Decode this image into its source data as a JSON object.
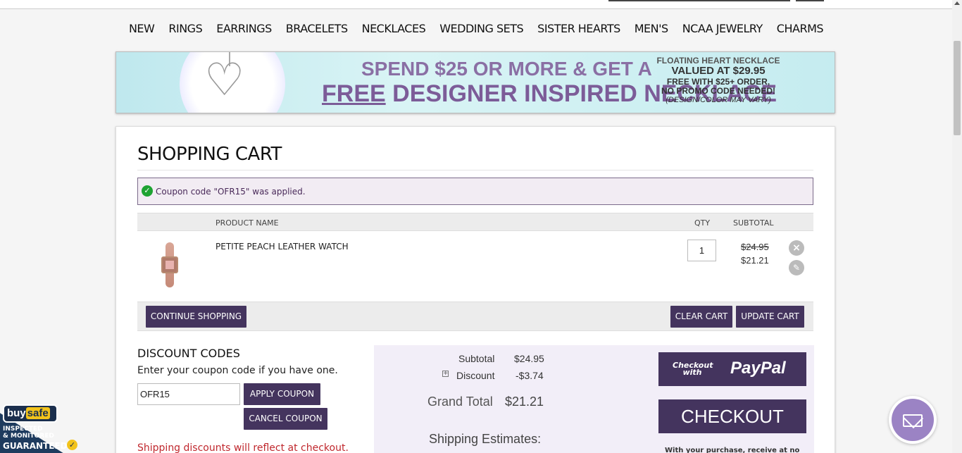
{
  "nav": [
    "NEW",
    "RINGS",
    "EARRINGS",
    "BRACELETS",
    "NECKLACES",
    "WEDDING SETS",
    "SISTER HEARTS",
    "MEN'S",
    "NCAA JEWELRY",
    "CHARMS"
  ],
  "banner": {
    "line1": "SPEND $25 OR MORE & GET A",
    "line2_free": "FREE",
    "line2_rest": " DESIGNER INSPIRED NECKLACE",
    "right1": "FLOATING HEART NECKLACE",
    "right2": "VALUED AT $29.95",
    "right3": "FREE WITH $25+ ORDER,",
    "right4": "NO PROMO CODE NEEDED!",
    "right5": "(DESIGN/COLOR MAY VARY)"
  },
  "cart": {
    "title": "SHOPPING CART",
    "message": "Coupon code \"OFR15\" was applied.",
    "headers": {
      "product": "PRODUCT NAME",
      "qty": "QTY",
      "subtotal": "SUBTOTAL"
    },
    "item": {
      "name": "PETITE PEACH LEATHER WATCH",
      "qty": "1",
      "old_price": "$24.95",
      "new_price": "$21.21"
    },
    "buttons": {
      "continue": "CONTINUE SHOPPING",
      "clear": "CLEAR CART",
      "update": "UPDATE CART"
    }
  },
  "discount": {
    "title": "DISCOUNT CODES",
    "subtitle": "Enter your coupon code if you have one.",
    "code": "OFR15",
    "apply": "APPLY COUPON",
    "cancel": "CANCEL COUPON",
    "ship_note": "Shipping discounts will reflect at checkout."
  },
  "totals": {
    "subtotal_label": "Subtotal",
    "subtotal_value": "$24.95",
    "discount_label": "Discount",
    "discount_value": "-$3.74",
    "grand_label": "Grand Total",
    "grand_value": "$21.21",
    "shipping_estimates": "Shipping Estimates:",
    "paypal_checkout_with": "Checkout with",
    "paypal_brand": "PayPal",
    "checkout": "CHECKOUT",
    "purchase_note": "With your purchase, receive at no cost:"
  },
  "buysafe": {
    "logo": "buy",
    "logo_b": "safe",
    "line1": "INSPECTED",
    "line2": "& MONITORED",
    "line3": "GUARANTEED"
  },
  "colors": {
    "primary_button": "#44345e",
    "message_bg": "#f2ecf3",
    "totals_bg": "#f2eef8",
    "ship_note": "#c0272d"
  }
}
